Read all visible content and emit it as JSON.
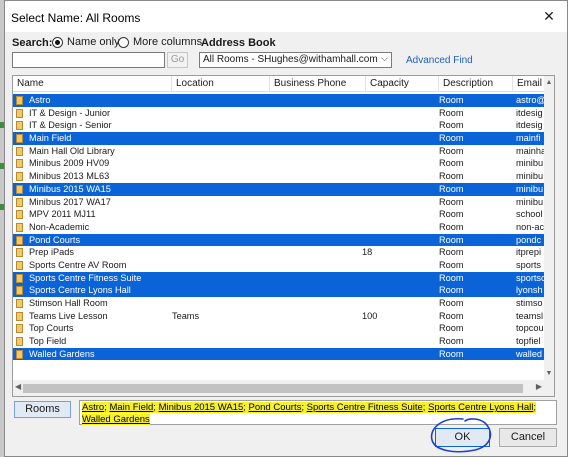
{
  "dialog": {
    "title": "Select Name: All Rooms",
    "close_glyph": "✕"
  },
  "search": {
    "label": "Search:",
    "option_name_only": "Name only",
    "option_more_columns": "More columns",
    "selected_option": "Name only",
    "input_value": "",
    "go_label": "Go"
  },
  "address_book": {
    "label": "Address Book",
    "selected_value": "All Rooms - SHughes@withamhall.com",
    "chevron": "⌵",
    "advanced_find": "Advanced Find"
  },
  "table": {
    "columns": [
      "Name",
      "Location",
      "Business Phone",
      "Capacity",
      "Description",
      "Email Ad"
    ],
    "rows": [
      {
        "name": "Astro",
        "location": "",
        "phone": "",
        "capacity": "",
        "description": "Room",
        "email": "astro@",
        "selected": true
      },
      {
        "name": "IT & Design - Junior",
        "location": "",
        "phone": "",
        "capacity": "",
        "description": "Room",
        "email": "itdesig",
        "selected": false
      },
      {
        "name": "IT & Design - Senior",
        "location": "",
        "phone": "",
        "capacity": "",
        "description": "Room",
        "email": "itdesig",
        "selected": false
      },
      {
        "name": "Main Field",
        "location": "",
        "phone": "",
        "capacity": "",
        "description": "Room",
        "email": "mainfi",
        "selected": true
      },
      {
        "name": "Main Hall Old Library",
        "location": "",
        "phone": "",
        "capacity": "",
        "description": "Room",
        "email": "mainha",
        "selected": false
      },
      {
        "name": "Minibus 2009 HV09",
        "location": "",
        "phone": "",
        "capacity": "",
        "description": "Room",
        "email": "minibu",
        "selected": false
      },
      {
        "name": "Minibus 2013 ML63",
        "location": "",
        "phone": "",
        "capacity": "",
        "description": "Room",
        "email": "minibu",
        "selected": false
      },
      {
        "name": "Minibus 2015 WA15",
        "location": "",
        "phone": "",
        "capacity": "",
        "description": "Room",
        "email": "minibu",
        "selected": true
      },
      {
        "name": "Minibus 2017 WA17",
        "location": "",
        "phone": "",
        "capacity": "",
        "description": "Room",
        "email": "minibu",
        "selected": false
      },
      {
        "name": "MPV 2011 MJ11",
        "location": "",
        "phone": "",
        "capacity": "",
        "description": "Room",
        "email": "school",
        "selected": false
      },
      {
        "name": "Non-Academic",
        "location": "",
        "phone": "",
        "capacity": "",
        "description": "Room",
        "email": "non-ac",
        "selected": false
      },
      {
        "name": "Pond Courts",
        "location": "",
        "phone": "",
        "capacity": "",
        "description": "Room",
        "email": "pondc",
        "selected": true
      },
      {
        "name": "Prep iPads",
        "location": "",
        "phone": "",
        "capacity": "18",
        "description": "Room",
        "email": "itprepi",
        "selected": false
      },
      {
        "name": "Sports Centre AV Room",
        "location": "",
        "phone": "",
        "capacity": "",
        "description": "Room",
        "email": "sports",
        "selected": false
      },
      {
        "name": "Sports Centre Fitness Suite",
        "location": "",
        "phone": "",
        "capacity": "",
        "description": "Room",
        "email": "sportsc",
        "selected": true
      },
      {
        "name": "Sports Centre Lyons Hall",
        "location": "",
        "phone": "",
        "capacity": "",
        "description": "Room",
        "email": "lyonsh",
        "selected": true
      },
      {
        "name": "Stimson Hall Room",
        "location": "",
        "phone": "",
        "capacity": "",
        "description": "Room",
        "email": "stimso",
        "selected": false
      },
      {
        "name": "Teams Live Lesson",
        "location": "Teams",
        "phone": "",
        "capacity": "100",
        "description": "Room",
        "email": "teamsl",
        "selected": false
      },
      {
        "name": "Top Courts",
        "location": "",
        "phone": "",
        "capacity": "",
        "description": "Room",
        "email": "topcou",
        "selected": false
      },
      {
        "name": "Top Field",
        "location": "",
        "phone": "",
        "capacity": "",
        "description": "Room",
        "email": "topfiel",
        "selected": false
      },
      {
        "name": "Walled Gardens",
        "location": "",
        "phone": "",
        "capacity": "",
        "description": "Room",
        "email": "walled",
        "selected": true
      }
    ]
  },
  "footer": {
    "rooms_button": "Rooms",
    "selected_names": [
      "Astro",
      "Main Field",
      "Minibus 2015 WA15",
      "Pond Courts",
      "Sports Centre Fitness Suite",
      "Sports Centre Lyons Hall",
      "Walled Gardens"
    ],
    "separator": ";",
    "ok_label": "OK",
    "cancel_label": "Cancel"
  },
  "colors": {
    "selection": "#0a64d8",
    "highlight": "#f6f02a",
    "annotation": "#1f3fd0"
  }
}
